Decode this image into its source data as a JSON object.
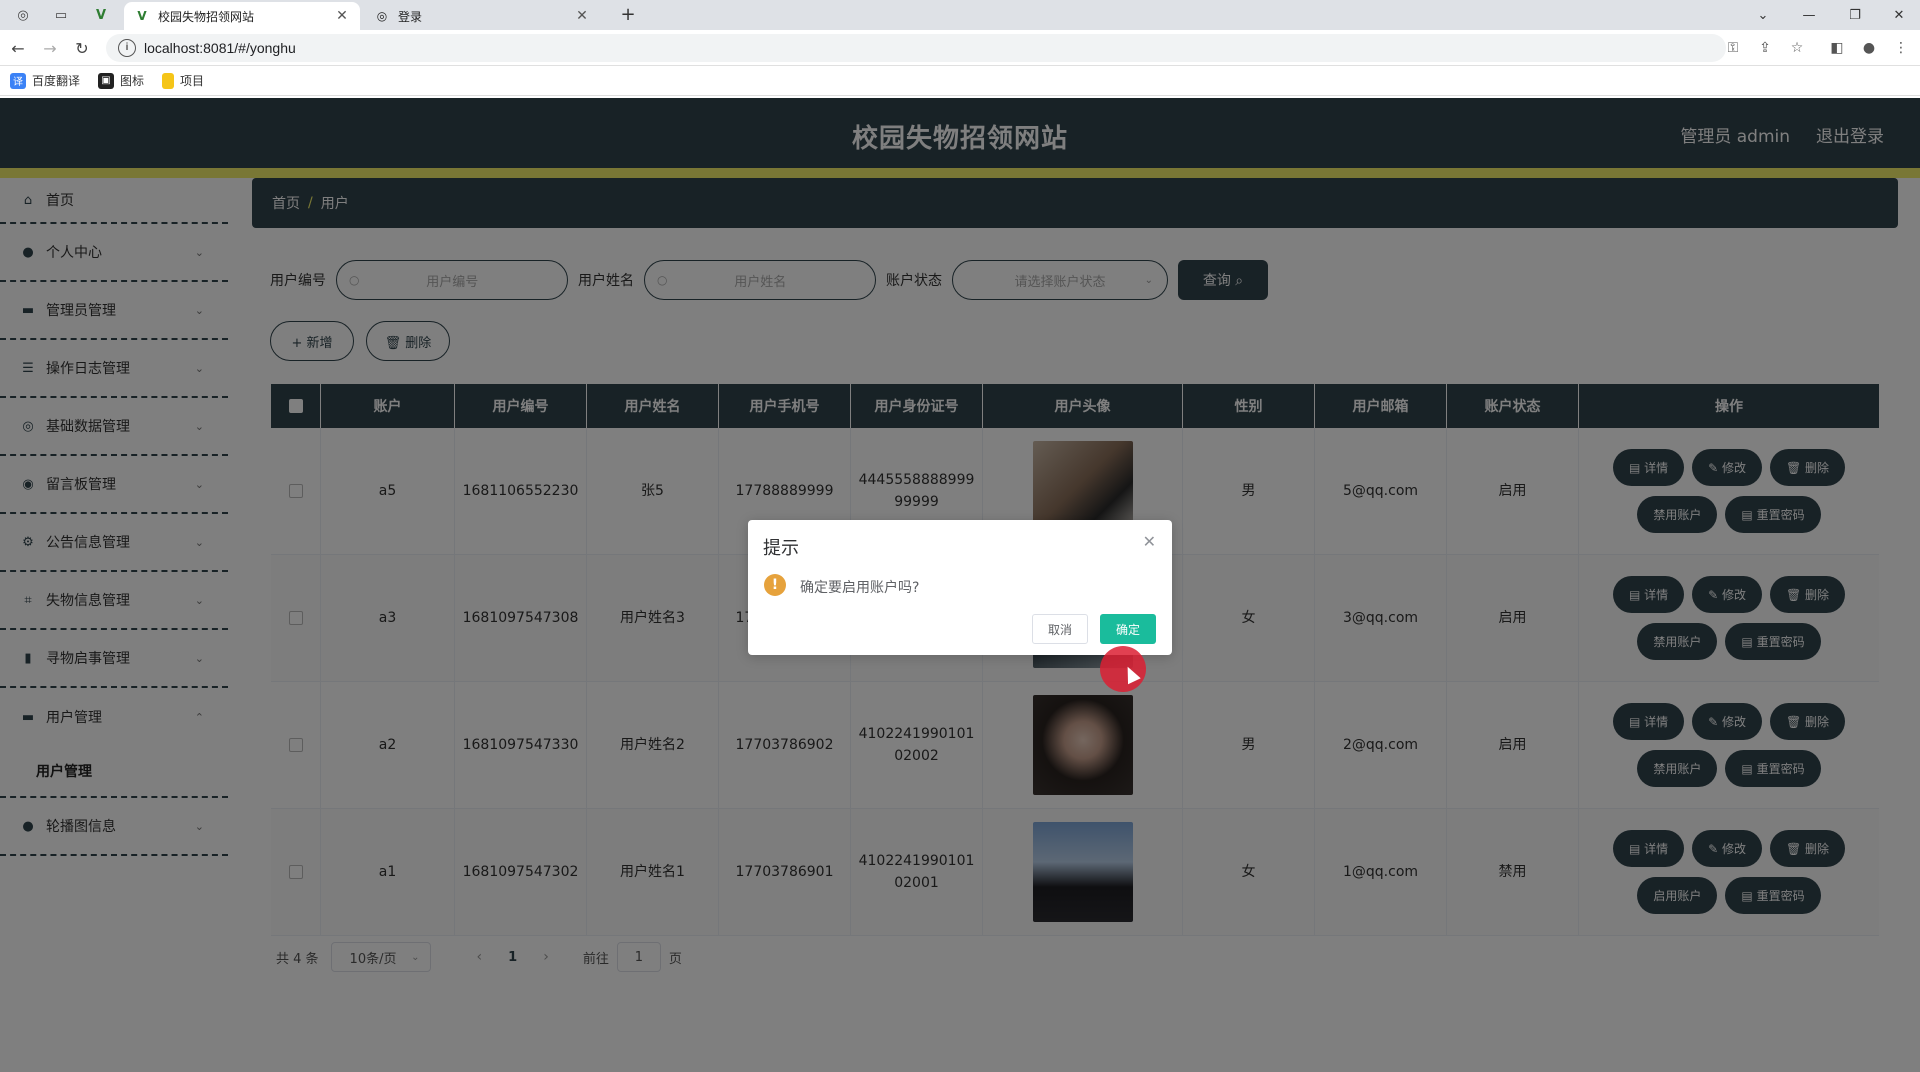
{
  "browser": {
    "tabs": [
      {
        "title": "校园失物招领网站",
        "active": true
      },
      {
        "title": "登录",
        "active": false
      }
    ],
    "url": "localhost:8081/#/yonghu",
    "bookmarks": [
      {
        "label": "百度翻译",
        "icon": "translate-icon",
        "color": "#3b82f6"
      },
      {
        "label": "图标",
        "icon": "image-icon",
        "color": "#222222"
      },
      {
        "label": "项目",
        "icon": "folder-icon",
        "color": "#f5c518"
      }
    ]
  },
  "header": {
    "title": "校园失物招领网站",
    "user": "管理员 admin",
    "logout": "退出登录"
  },
  "sidebar": {
    "items": [
      {
        "label": "首页",
        "icon": "home-icon"
      },
      {
        "label": "个人中心",
        "icon": "user-icon"
      },
      {
        "label": "管理员管理",
        "icon": "monitor-icon"
      },
      {
        "label": "操作日志管理",
        "icon": "list-icon"
      },
      {
        "label": "基础数据管理",
        "icon": "globe-icon"
      },
      {
        "label": "留言板管理",
        "icon": "pin-icon"
      },
      {
        "label": "公告信息管理",
        "icon": "settings-icon"
      },
      {
        "label": "失物信息管理",
        "icon": "crop-icon"
      },
      {
        "label": "寻物启事管理",
        "icon": "trash-icon"
      },
      {
        "label": "用户管理",
        "icon": "chat-icon"
      },
      {
        "label": "轮播图信息",
        "icon": "user-icon"
      }
    ],
    "submenu_label": "用户管理"
  },
  "breadcrumb": {
    "home": "首页",
    "separator": "/",
    "current": "用户"
  },
  "search": {
    "user_no_label": "用户编号",
    "user_no_placeholder": "用户编号",
    "user_name_label": "用户姓名",
    "user_name_placeholder": "用户姓名",
    "status_label": "账户状态",
    "status_placeholder": "请选择账户状态",
    "query_button": "查询 ⌕"
  },
  "actions": {
    "add": "+ 新增",
    "delete": "🗑 删除"
  },
  "table": {
    "headers": [
      "账户",
      "用户编号",
      "用户姓名",
      "用户手机号",
      "用户身份证号",
      "用户头像",
      "性别",
      "用户邮箱",
      "账户状态",
      "操作"
    ],
    "rows": [
      {
        "account": "a5",
        "user_no": "1681106552230",
        "name": "张5",
        "phone": "17788889999",
        "id_card": "444555888899999999",
        "gender": "男",
        "email": "5@qq.com",
        "status": "启用",
        "toggle_label": "禁用账户"
      },
      {
        "account": "a3",
        "user_no": "1681097547308",
        "name": "用户姓名3",
        "phone": "17703786903",
        "id_card": "410224199010102003",
        "gender": "女",
        "email": "3@qq.com",
        "status": "启用",
        "toggle_label": "禁用账户"
      },
      {
        "account": "a2",
        "user_no": "1681097547330",
        "name": "用户姓名2",
        "phone": "17703786902",
        "id_card": "410224199010102002",
        "gender": "男",
        "email": "2@qq.com",
        "status": "启用",
        "toggle_label": "禁用账户"
      },
      {
        "account": "a1",
        "user_no": "1681097547302",
        "name": "用户姓名1",
        "phone": "17703786901",
        "id_card": "410224199010102001",
        "gender": "女",
        "email": "1@qq.com",
        "status": "禁用",
        "toggle_label": "启用账户"
      }
    ],
    "op_detail": "▤ 详情",
    "op_edit": "✎ 修改",
    "op_delete": "🗑 删除",
    "op_reset": "▤ 重置密码"
  },
  "pagination": {
    "total": "共 4 条",
    "page_size": "10条/页",
    "current_page": "1",
    "goto_prefix": "前往",
    "goto_value": "1",
    "goto_suffix": "页"
  },
  "dialog": {
    "title": "提示",
    "message": "确定要启用账户吗?",
    "cancel": "取消",
    "confirm": "确定"
  },
  "colors": {
    "primary": "#30444d",
    "accent_stripe": "#f3ef6a",
    "confirm": "#1abc9c",
    "warning": "#e6a23c"
  }
}
